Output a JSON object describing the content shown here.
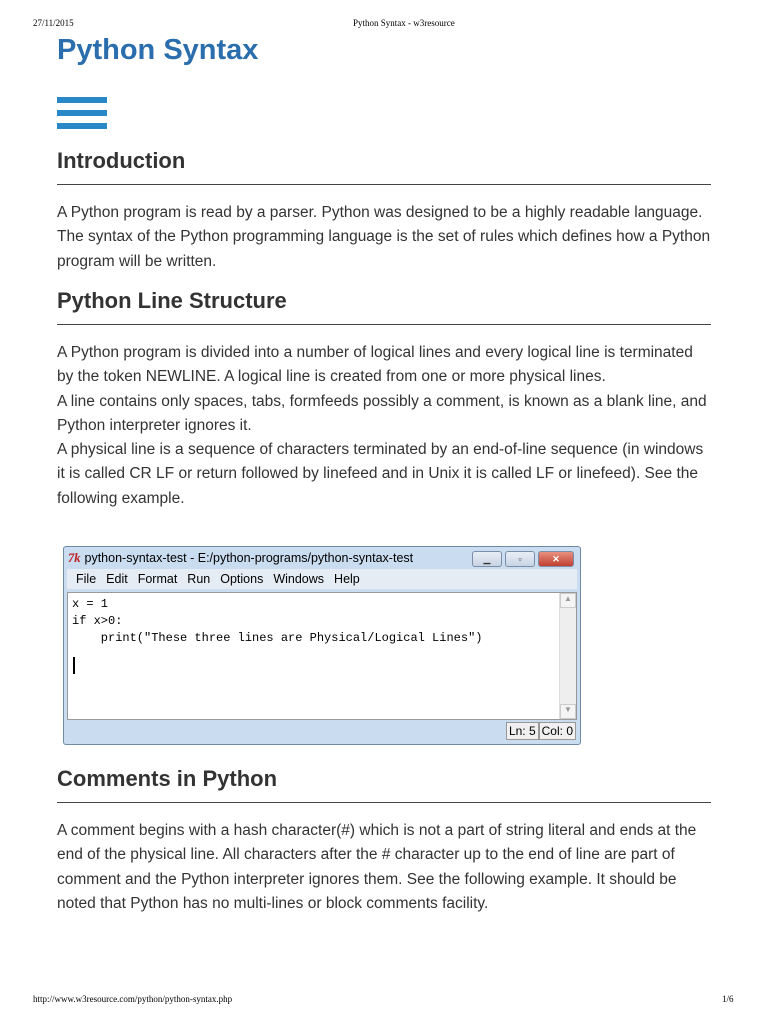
{
  "print_header": {
    "date": "27/11/2015",
    "title": "Python Syntax - w3resource"
  },
  "page_title": "Python Syntax",
  "sections": [
    {
      "heading": "Introduction",
      "paragraphs": [
        "A Python program is read by a parser. Python was designed to be a highly readable language. The syntax of the Python programming language is the set of rules which defines how a Python program will be written."
      ]
    },
    {
      "heading": "Python Line Structure",
      "paragraphs": [
        "A Python program is divided into a number of logical lines and every logical line is terminated by the token NEWLINE. A logical line is created from one or more physical lines.",
        "A line contains only spaces, tabs, formfeeds possibly a comment, is known as a blank line, and Python interpreter ignores it.",
        "A physical line is a sequence of characters terminated by an end-of-line sequence (in windows it is called CR LF or return followed by linefeed and in Unix it is called LF or linefeed). See the following example."
      ]
    },
    {
      "heading": "Comments in Python",
      "paragraphs": [
        "A comment begins with a hash character(#) which is not a part of string literal and ends at the end of the physical line. All characters after the # character up to the end of line are part of comment and the Python interpreter ignores them. See the following example. It should be noted that Python has no multi-lines or block comments facility."
      ]
    }
  ],
  "idle_window": {
    "title": "python-syntax-test - E:/python-programs/python-syntax-test",
    "menu": [
      "File",
      "Edit",
      "Format",
      "Run",
      "Options",
      "Windows",
      "Help"
    ],
    "code": "x = 1\nif x>0:\n    print(\"These three lines are Physical/Logical Lines\")",
    "status_ln": "Ln: 5",
    "status_col": "Col: 0"
  },
  "print_footer": {
    "url": "http://www.w3resource.com/python/python-syntax.php",
    "page": "1/6"
  }
}
